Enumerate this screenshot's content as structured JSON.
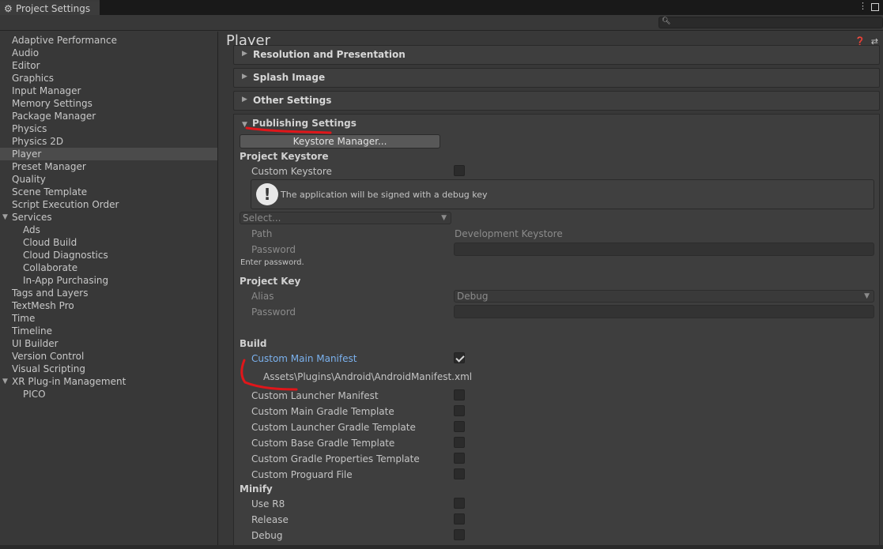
{
  "window": {
    "tab_title": "Project Settings",
    "search_placeholder": ""
  },
  "sidebar": {
    "items": [
      {
        "label": "Adaptive Performance"
      },
      {
        "label": "Audio"
      },
      {
        "label": "Editor"
      },
      {
        "label": "Graphics"
      },
      {
        "label": "Input Manager"
      },
      {
        "label": "Memory Settings"
      },
      {
        "label": "Package Manager"
      },
      {
        "label": "Physics"
      },
      {
        "label": "Physics 2D"
      },
      {
        "label": "Player"
      },
      {
        "label": "Preset Manager"
      },
      {
        "label": "Quality"
      },
      {
        "label": "Scene Template"
      },
      {
        "label": "Script Execution Order"
      },
      {
        "label": "Services"
      },
      {
        "label": "Ads"
      },
      {
        "label": "Cloud Build"
      },
      {
        "label": "Cloud Diagnostics"
      },
      {
        "label": "Collaborate"
      },
      {
        "label": "In-App Purchasing"
      },
      {
        "label": "Tags and Layers"
      },
      {
        "label": "TextMesh Pro"
      },
      {
        "label": "Time"
      },
      {
        "label": "Timeline"
      },
      {
        "label": "UI Builder"
      },
      {
        "label": "Version Control"
      },
      {
        "label": "Visual Scripting"
      },
      {
        "label": "XR Plug-in Management"
      },
      {
        "label": "PICO"
      }
    ],
    "selected": "Player"
  },
  "main": {
    "title": "Player",
    "foldouts": {
      "resolution": "Resolution and Presentation",
      "splash": "Splash Image",
      "other": "Other Settings",
      "publishing": "Publishing Settings"
    },
    "publishing": {
      "keystore_button": "Keystore Manager...",
      "project_keystore": "Project Keystore",
      "custom_keystore": "Custom Keystore",
      "custom_keystore_checked": false,
      "help_text": "The application will be signed with a debug key",
      "select_placeholder": "Select...",
      "path_label": "Path",
      "path_value": "Development Keystore",
      "password_label": "Password",
      "enter_password": "Enter password.",
      "project_key": "Project Key",
      "alias_label": "Alias",
      "alias_value": "Debug",
      "key_password_label": "Password",
      "build_header": "Build",
      "custom_main_manifest": "Custom Main Manifest",
      "custom_main_manifest_checked": true,
      "manifest_path": "Assets\\Plugins\\Android\\AndroidManifest.xml",
      "build_options": [
        {
          "label": "Custom Launcher Manifest",
          "checked": false
        },
        {
          "label": "Custom Main Gradle Template",
          "checked": false
        },
        {
          "label": "Custom Launcher Gradle Template",
          "checked": false
        },
        {
          "label": "Custom Base Gradle Template",
          "checked": false
        },
        {
          "label": "Custom Gradle Properties Template",
          "checked": false
        },
        {
          "label": "Custom Proguard File",
          "checked": false
        }
      ],
      "minify_header": "Minify",
      "minify_options": [
        {
          "label": "Use R8",
          "checked": false
        },
        {
          "label": "Release",
          "checked": false
        },
        {
          "label": "Debug",
          "checked": false
        }
      ]
    }
  },
  "colors": {
    "background": "#383838",
    "selected_row": "#4b4b4b",
    "link_blue": "#7bb2ef",
    "annotation_red": "#e0161a"
  }
}
